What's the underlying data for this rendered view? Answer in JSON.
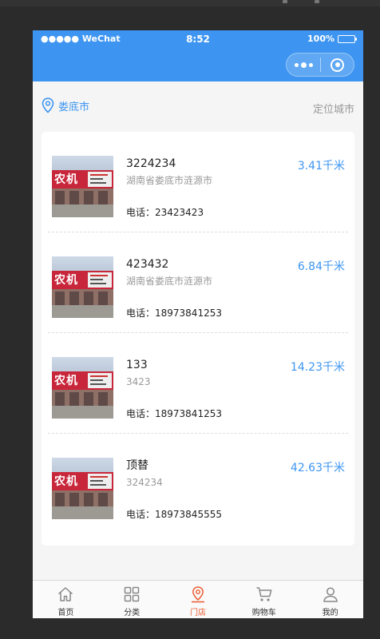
{
  "status_bar": {
    "carrier": "●●●●● WeChat",
    "time": "8:52",
    "battery": "100%"
  },
  "location": {
    "city": "娄底市",
    "locate_label": "定位城市",
    "icon": "location-pin-icon"
  },
  "stores": [
    {
      "name": "3224234",
      "address": "湖南省娄底市涟源市",
      "phone": "电话：23423423",
      "distance": "3.41千米"
    },
    {
      "name": "423432",
      "address": "湖南省娄底市涟源市",
      "phone": "电话：18973841253",
      "distance": "6.84千米"
    },
    {
      "name": "133",
      "address": "3423",
      "phone": "电话：18973841253",
      "distance": "14.23千米"
    },
    {
      "name": "顶替",
      "address": "324234",
      "phone": "电话：18973845555",
      "distance": "42.63千米"
    }
  ],
  "tabbar": {
    "items": [
      {
        "label": "首页",
        "icon": "home-icon"
      },
      {
        "label": "分类",
        "icon": "category-grid-icon"
      },
      {
        "label": "门店",
        "icon": "store-location-icon"
      },
      {
        "label": "购物车",
        "icon": "cart-icon"
      },
      {
        "label": "我的",
        "icon": "user-icon"
      }
    ],
    "active_index": 2
  },
  "colors": {
    "accent": "#3d95f1",
    "tab_active": "#e95b2e",
    "header_bg": "#3d95f1"
  }
}
